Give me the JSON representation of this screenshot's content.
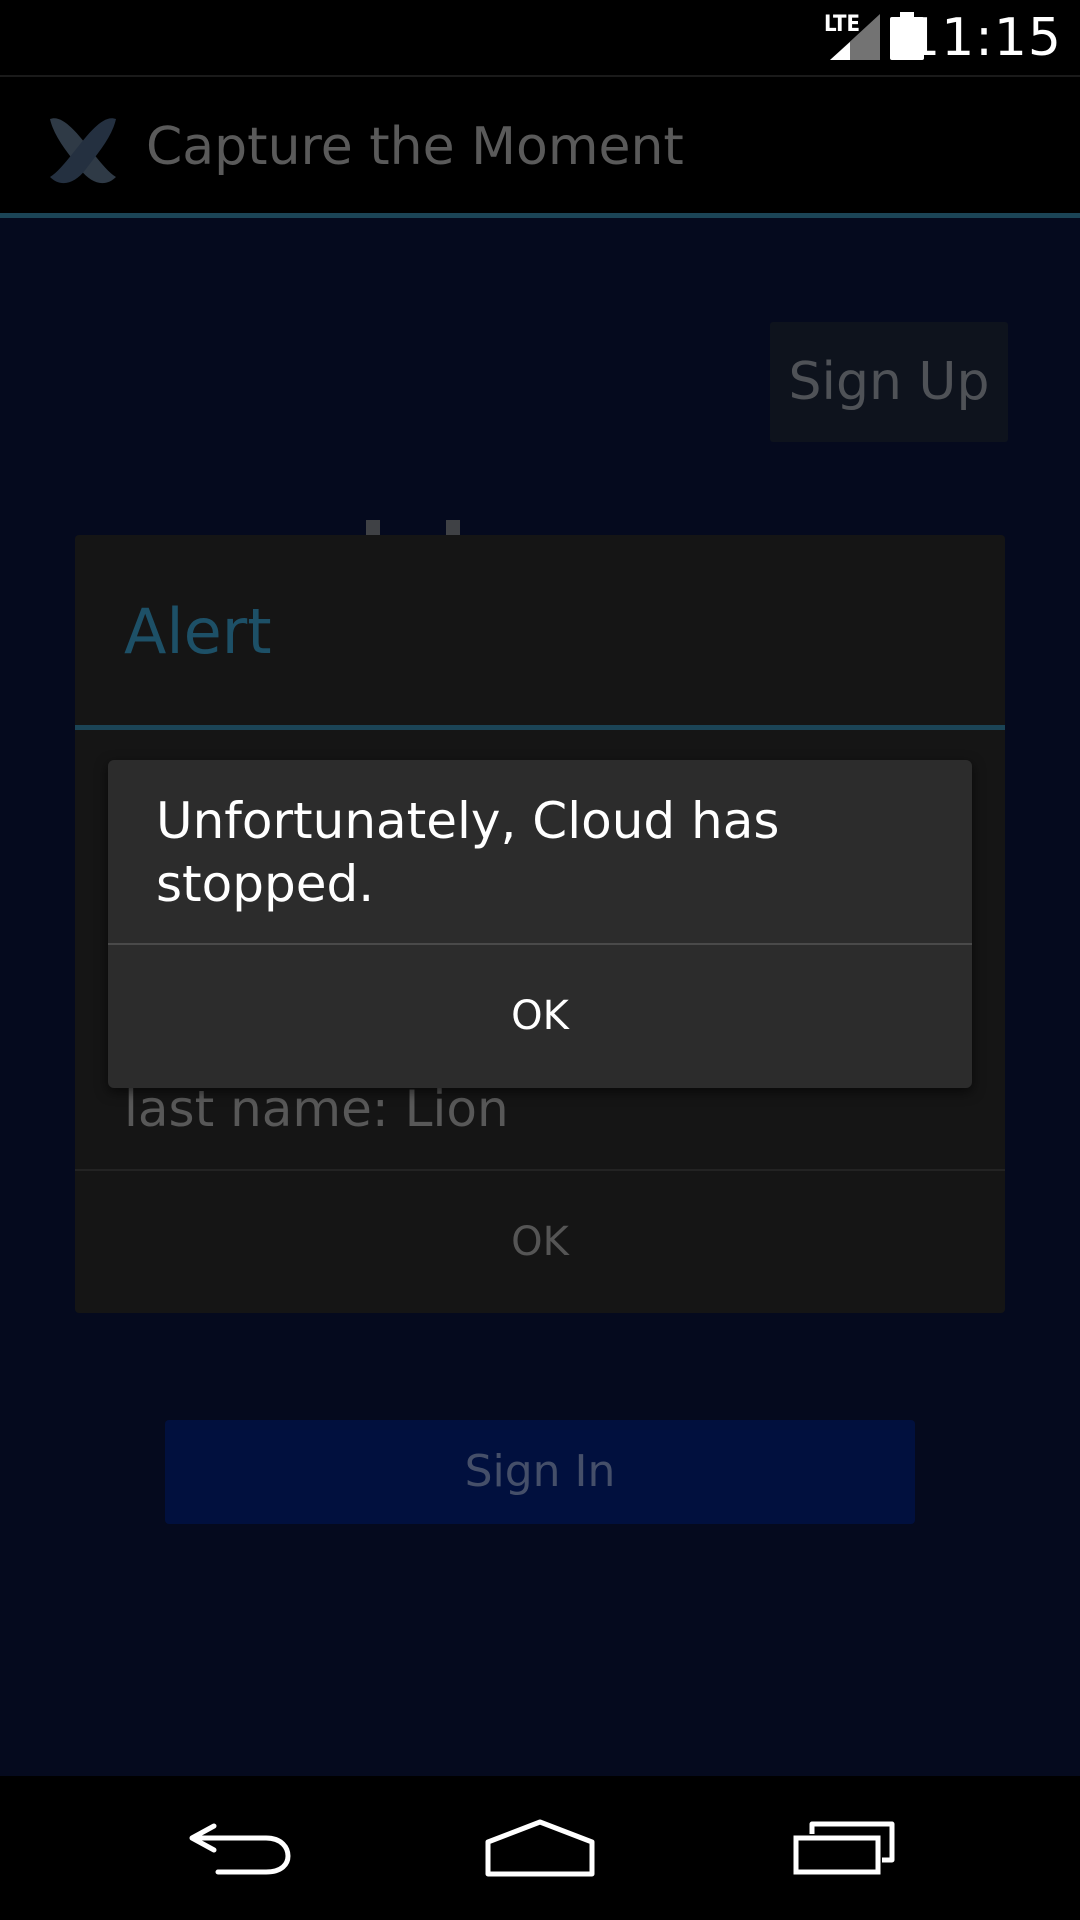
{
  "status_bar": {
    "network": "LTE",
    "time": "11:15",
    "icons": [
      "lte-icon",
      "signal-icon",
      "battery-icon"
    ]
  },
  "action_bar": {
    "app_icon": "app-logo-icon",
    "title": "Capture the Moment"
  },
  "content": {
    "signup_label": "Sign Up",
    "signin_label": "Sign In"
  },
  "alert_dialog": {
    "title": "Alert",
    "message": "last name: Lion",
    "ok_label": "OK"
  },
  "crash_dialog": {
    "message": "Unfortunately, Cloud has stopped.",
    "ok_label": "OK"
  },
  "nav_bar": {
    "items": [
      "back-icon",
      "home-icon",
      "recents-icon"
    ]
  },
  "colors": {
    "accent": "#1b4456",
    "alert_title": "#1d5067",
    "content_bg": "#050a1e",
    "signin_bg": "#01103e"
  }
}
